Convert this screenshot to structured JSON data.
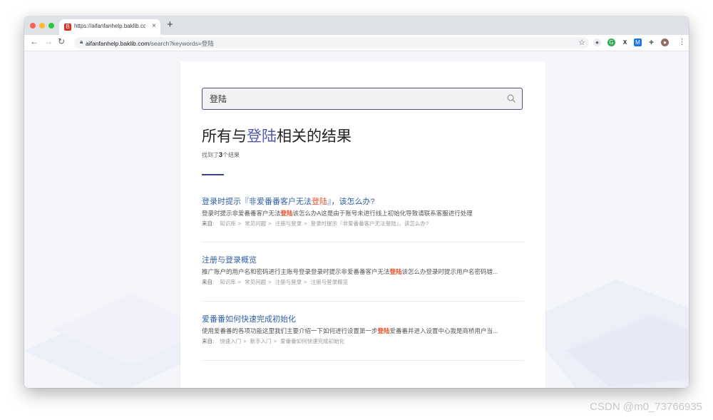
{
  "browser": {
    "tab_title": "https://aifanfanhelp.baklib.com",
    "tab_close": "×",
    "new_tab": "+",
    "url_host": "aifanfanhelp.baklib.com",
    "url_path": "/search?keywords=登陆",
    "nav": {
      "back": "←",
      "forward": "→",
      "reload": "↻"
    },
    "bookmark_star": "☆",
    "menu": "⋮"
  },
  "search": {
    "value": "登陆",
    "icon": "search-icon"
  },
  "heading": {
    "prefix": "所有与",
    "keyword": "登陆",
    "suffix": "相关的结果"
  },
  "count": {
    "prefix": "找到了",
    "number": "3",
    "suffix": "个结果"
  },
  "crumb_from": "来自:",
  "results": [
    {
      "title_pre": "登录时提示『非爱番番客户无法",
      "title_kw": "登陆",
      "title_post": "』，该怎么办?",
      "snippet_pre": "登录时提示非爱番番客户无法",
      "snippet_kw": "登陆",
      "snippet_post": "该怎么办A这是由于账号未进行线上初始化导致请联系客服进行处理",
      "crumbs": [
        "知识库",
        "常见问题",
        "注册与登录",
        "登录时提示『非爱番番客户无法登陆』，该怎么办?"
      ]
    },
    {
      "title_pre": "注册与登录概览",
      "title_kw": "",
      "title_post": "",
      "snippet_pre": "推广账户的用户名和密码进行主账号登录登录时提示非爱番番客户无法",
      "snippet_kw": "登陆",
      "snippet_post": "该怎么办登录时提示用户名密码错...",
      "crumbs": [
        "知识库",
        "常见问题",
        "注册与登录",
        "注册与登录概览"
      ]
    },
    {
      "title_pre": "爱番番如何快速完成初始化",
      "title_kw": "",
      "title_post": "",
      "snippet_pre": "使用爱番番的各项功能这里我们主要介绍一下如何进行设置第一步",
      "snippet_kw": "登陆",
      "snippet_post": "爱番番并进入设置中心我是商桥用户当...",
      "crumbs": [
        "快速入门",
        "新手入门",
        "爱番番如何快速完成初始化"
      ]
    }
  ],
  "watermark": "CSDN @m0_73766935",
  "colors": {
    "accent": "#3e4389",
    "keyword_heading": "#5158a8",
    "result_title": "#2f5fa5",
    "highlight": "#e5502a"
  }
}
